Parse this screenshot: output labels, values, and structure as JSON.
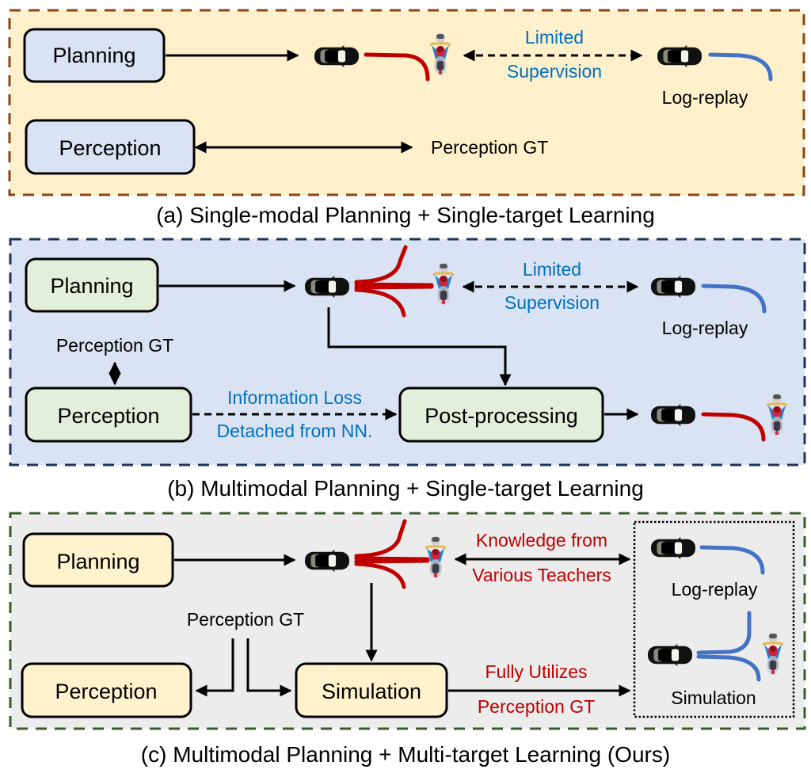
{
  "colors": {
    "panel_a_bg": "#fff0cc",
    "panel_a_border": "#8b4513",
    "panel_a_box_fill": "#dae3f3",
    "panel_b_bg": "#dae3f3",
    "panel_b_border": "#1f3455",
    "panel_b_box_fill": "#e2efda",
    "panel_c_bg": "#ececec",
    "panel_c_border": "#3d5b2a",
    "panel_c_box_fill": "#fff2cc",
    "trajectory_red": "#c00000",
    "trajectory_blue": "#4472c4",
    "blue_text": "#0070c0",
    "red_text": "#c00000"
  },
  "panel_a": {
    "caption": "(a) Single-modal Planning + Single-target Learning",
    "planning_box": "Planning",
    "perception_box": "Perception",
    "perception_target": "Perception GT",
    "supervision_line1": "Limited",
    "supervision_line2": "Supervision",
    "log_replay": "Log-replay"
  },
  "panel_b": {
    "caption": "(b) Multimodal Planning + Single-target Learning",
    "planning_box": "Planning",
    "perception_box": "Perception",
    "perception_gt": "Perception GT",
    "postprocessing_box": "Post-processing",
    "supervision_line1": "Limited",
    "supervision_line2": "Supervision",
    "log_replay": "Log-replay",
    "info_loss_line1": "Information Loss",
    "info_loss_line2": "Detached from NN."
  },
  "panel_c": {
    "caption": "(c) Multimodal Planning + Multi-target Learning (Ours)",
    "planning_box": "Planning",
    "perception_box": "Perception",
    "perception_gt": "Perception GT",
    "simulation_box": "Simulation",
    "knowledge_line1": "Knowledge from",
    "knowledge_line2": "Various Teachers",
    "fully_line1": "Fully Utilizes",
    "fully_line2": "Perception GT",
    "log_replay": "Log-replay",
    "simulation_label": "Simulation"
  }
}
